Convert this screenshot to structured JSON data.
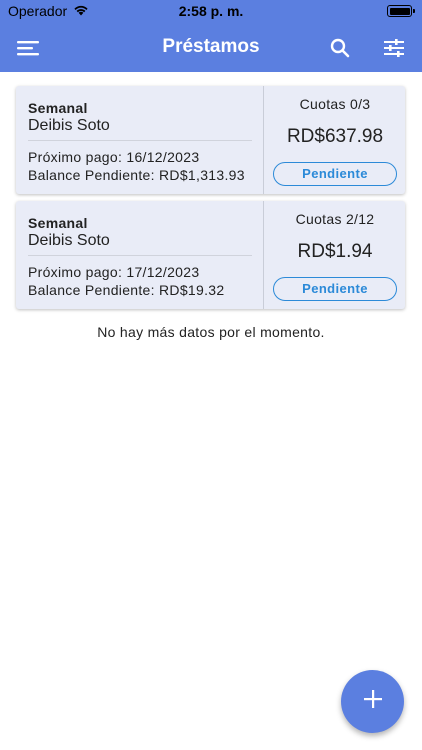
{
  "status_bar": {
    "carrier": "Operador",
    "time": "2:58 p. m.",
    "wifi_icon": "wifi-icon",
    "battery_icon": "battery-icon"
  },
  "app_bar": {
    "title": "Préstamos",
    "menu_icon": "menu-icon",
    "search_icon": "search-icon",
    "filter_icon": "filter-sliders-icon",
    "color": "#5b7fe0"
  },
  "loans": [
    {
      "frequency": "Semanal",
      "client": "Deibis Soto",
      "next_payment": "Próximo pago: 16/12/2023",
      "balance": "Balance Pendiente: RD$1,313.93",
      "installments": "Cuotas 0/3",
      "amount": "RD$637.98",
      "status": "Pendiente"
    },
    {
      "frequency": "Semanal",
      "client": "Deibis Soto",
      "next_payment": "Próximo pago: 17/12/2023",
      "balance": "Balance Pendiente: RD$19.32",
      "installments": "Cuotas 2/12",
      "amount": "RD$1.94",
      "status": "Pendiente"
    }
  ],
  "empty_message": "No hay más datos por el momento.",
  "fab": {
    "icon": "plus-icon"
  },
  "colors": {
    "accent": "#5b7fe0",
    "status_pending": "#2c8ad8",
    "card_bg": "#e9ecf7"
  }
}
